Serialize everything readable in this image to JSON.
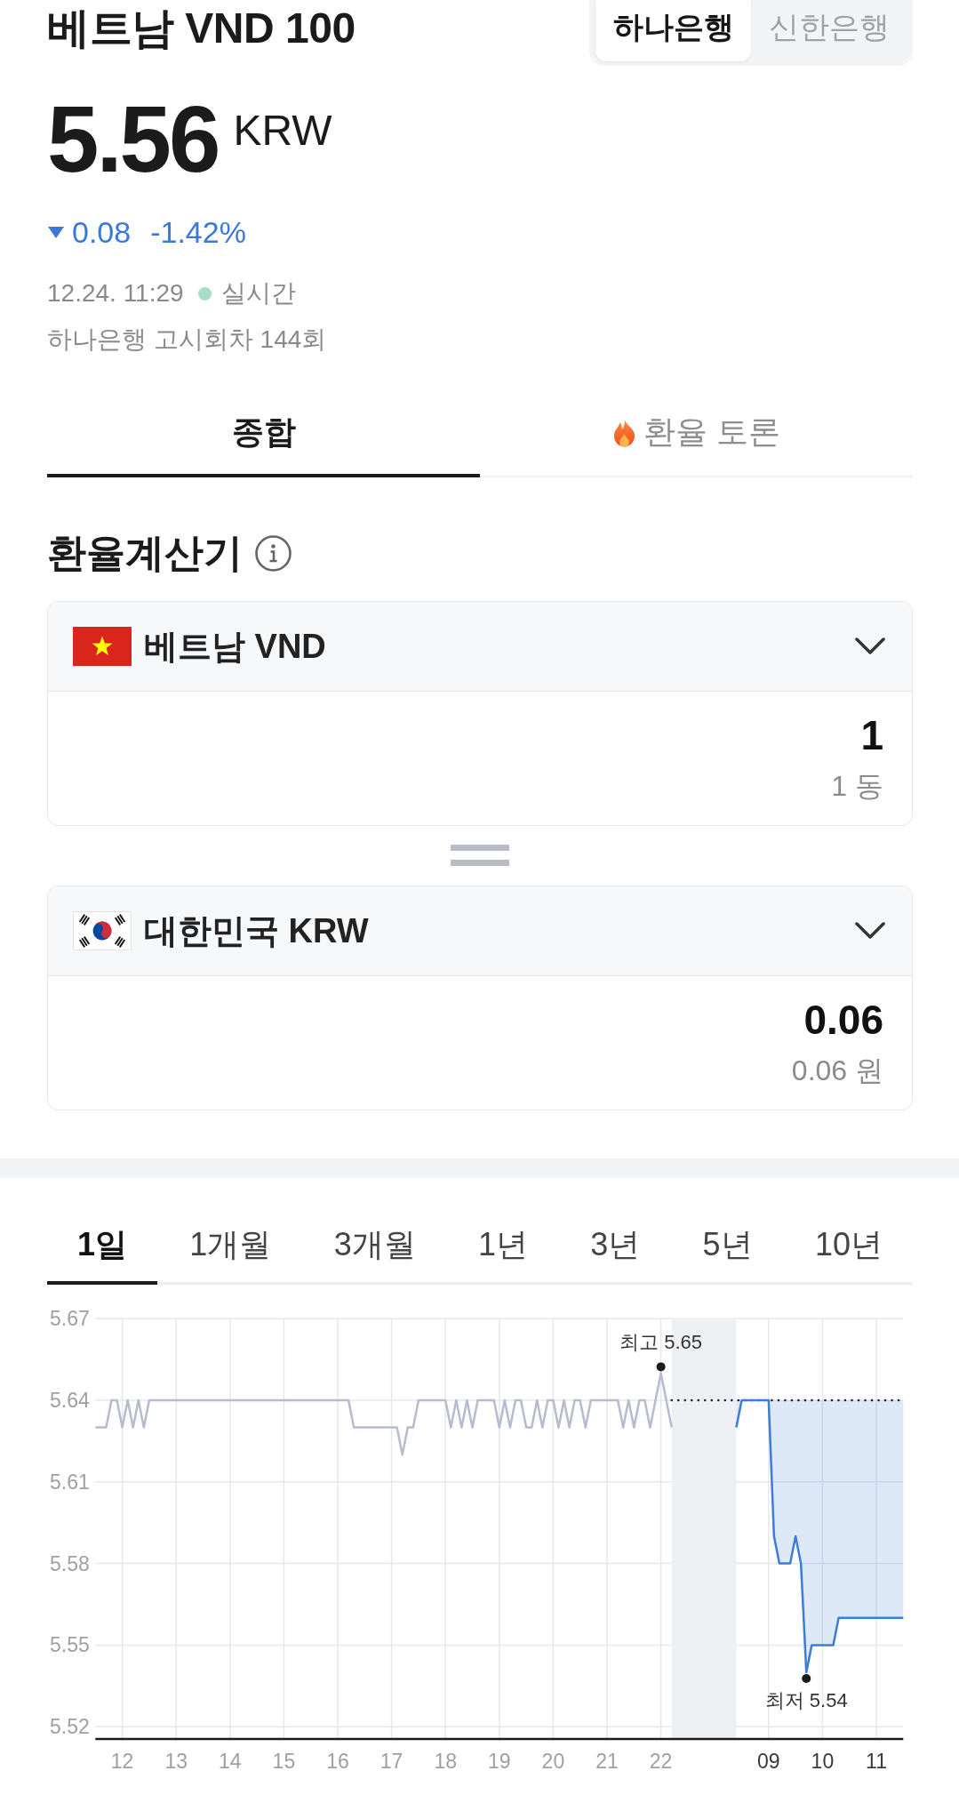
{
  "header": {
    "title": "베트남 VND 100",
    "banks": [
      {
        "label": "하나은행",
        "selected": true
      },
      {
        "label": "신한은행",
        "selected": false
      }
    ]
  },
  "quote": {
    "price": "5.56",
    "unit": "KRW",
    "falling": true,
    "change": "0.08",
    "change_rate": "-1.42%",
    "time": "12.24. 11:29",
    "live": true,
    "live_label": "실시간",
    "notice": "하나은행 고시회차 144회"
  },
  "tabs": [
    {
      "label": "종합",
      "selected": true,
      "kind": "plain"
    },
    {
      "label": "환율 토론",
      "selected": false,
      "kind": "fire"
    }
  ],
  "calculator": {
    "title": "환율계산기",
    "currencies": [
      {
        "kind": "vietnam",
        "name": "베트남 VND",
        "amount": "1",
        "amount_text": "1 동"
      },
      {
        "kind": "korea",
        "name": "대한민국 KRW",
        "amount": "0.06",
        "amount_text": "0.06 원"
      }
    ]
  },
  "chart": {
    "periods": [
      {
        "label": "1일",
        "selected": true
      },
      {
        "label": "1개월",
        "selected": false
      },
      {
        "label": "3개월",
        "selected": false
      },
      {
        "label": "1년",
        "selected": false
      },
      {
        "label": "3년",
        "selected": false
      },
      {
        "label": "5년",
        "selected": false
      },
      {
        "label": "10년",
        "selected": false
      }
    ],
    "chart_data": {
      "type": "line",
      "grid": true,
      "categories": [
        null,
        null,
        null,
        null,
        null,
        "12",
        null,
        null,
        null,
        null,
        null,
        null,
        null,
        null,
        null,
        "13",
        null,
        null,
        null,
        null,
        null,
        null,
        null,
        null,
        null,
        "14",
        null,
        null,
        null,
        null,
        null,
        null,
        null,
        null,
        null,
        "15",
        null,
        null,
        null,
        null,
        null,
        null,
        null,
        null,
        null,
        "16",
        null,
        null,
        null,
        null,
        null,
        null,
        null,
        null,
        null,
        "17",
        null,
        null,
        null,
        null,
        null,
        null,
        null,
        null,
        null,
        "18",
        null,
        null,
        null,
        null,
        null,
        null,
        null,
        null,
        null,
        "19",
        null,
        null,
        null,
        null,
        null,
        null,
        null,
        null,
        null,
        "20",
        null,
        null,
        null,
        null,
        null,
        null,
        null,
        null,
        null,
        "21",
        null,
        null,
        null,
        null,
        null,
        null,
        null,
        null,
        null,
        "22",
        null,
        null,
        null,
        null,
        null,
        null,
        null,
        null,
        null,
        null,
        null,
        null,
        null,
        null,
        null,
        null,
        null,
        null,
        null,
        "09",
        null,
        null,
        null,
        null,
        null,
        null,
        null,
        null,
        null,
        "10",
        null,
        null,
        null,
        null,
        null,
        null,
        null,
        null,
        null,
        "11",
        null,
        null,
        null,
        null,
        null
      ],
      "series": [
        {
          "color": "#b6bbd0",
          "values": [
            5.63,
            5.63,
            5.63,
            5.64,
            5.64,
            5.63,
            5.64,
            5.63,
            5.64,
            5.63,
            5.64,
            5.64,
            5.64,
            5.64,
            5.64,
            5.64,
            5.64,
            5.64,
            5.64,
            5.64,
            5.64,
            5.64,
            5.64,
            5.64,
            5.64,
            5.64,
            5.64,
            5.64,
            5.64,
            5.64,
            5.64,
            5.64,
            5.64,
            5.64,
            5.64,
            5.64,
            5.64,
            5.64,
            5.64,
            5.64,
            5.64,
            5.64,
            5.64,
            5.64,
            5.64,
            5.64,
            5.64,
            5.64,
            5.63,
            5.63,
            5.63,
            5.63,
            5.63,
            5.63,
            5.63,
            5.63,
            5.63,
            5.62,
            5.63,
            5.63,
            5.64,
            5.64,
            5.64,
            5.64,
            5.64,
            5.64,
            5.63,
            5.64,
            5.63,
            5.64,
            5.63,
            5.64,
            5.64,
            5.64,
            5.64,
            5.63,
            5.64,
            5.63,
            5.64,
            5.64,
            5.63,
            5.63,
            5.64,
            5.63,
            5.64,
            5.64,
            5.63,
            5.64,
            5.63,
            5.64,
            5.64,
            5.63,
            5.64,
            5.64,
            5.64,
            5.64,
            5.64,
            5.64,
            5.63,
            5.64,
            5.63,
            5.64,
            5.64,
            5.63,
            5.64,
            5.65,
            5.64,
            5.63,
            null,
            null,
            null,
            null,
            null,
            null,
            null,
            null,
            null,
            null,
            null,
            null,
            null,
            null,
            null,
            null,
            null,
            null,
            null,
            null,
            null,
            null,
            null,
            null,
            null,
            null,
            null,
            null,
            null,
            null,
            null,
            null,
            null,
            null,
            null,
            null,
            null,
            null,
            null,
            null,
            null,
            null,
            null
          ]
        },
        {
          "color": "#3b7dd8",
          "values": [
            null,
            null,
            null,
            null,
            null,
            null,
            null,
            null,
            null,
            null,
            null,
            null,
            null,
            null,
            null,
            null,
            null,
            null,
            null,
            null,
            null,
            null,
            null,
            null,
            null,
            null,
            null,
            null,
            null,
            null,
            null,
            null,
            null,
            null,
            null,
            null,
            null,
            null,
            null,
            null,
            null,
            null,
            null,
            null,
            null,
            null,
            null,
            null,
            null,
            null,
            null,
            null,
            null,
            null,
            null,
            null,
            null,
            null,
            null,
            null,
            null,
            null,
            null,
            null,
            null,
            null,
            null,
            null,
            null,
            null,
            null,
            null,
            null,
            null,
            null,
            null,
            null,
            null,
            null,
            null,
            null,
            null,
            null,
            null,
            null,
            null,
            null,
            null,
            null,
            null,
            null,
            null,
            null,
            null,
            null,
            null,
            null,
            null,
            null,
            null,
            null,
            null,
            null,
            null,
            null,
            null,
            null,
            null,
            null,
            null,
            null,
            null,
            null,
            null,
            null,
            null,
            null,
            null,
            null,
            5.63,
            5.64,
            5.64,
            5.64,
            5.64,
            5.64,
            5.64,
            5.59,
            5.58,
            5.58,
            5.58,
            5.59,
            5.58,
            5.54,
            5.55,
            5.55,
            5.55,
            5.55,
            5.55,
            5.56,
            5.56,
            5.56,
            5.56,
            5.56,
            5.56,
            5.56,
            5.56,
            5.56,
            5.56,
            5.56,
            5.56,
            5.56
          ]
        }
      ],
      "ylim": [
        5.5155,
        5.67
      ],
      "yticks": [
        5.52,
        5.55,
        5.58,
        5.61,
        5.64,
        5.67
      ],
      "annotations": [
        "최고 5.65",
        "최저 5.54"
      ],
      "ref_lines": [
        {
          "axis": "y",
          "value": 5.64
        }
      ]
    }
  }
}
